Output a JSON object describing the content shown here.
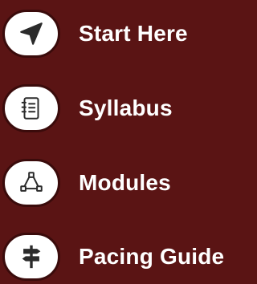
{
  "colors": {
    "background": "#5a1414",
    "circle_fill": "#ffffff",
    "circle_border": "#3a0b0b",
    "icon": "#2b2b2b",
    "label": "#ffffff"
  },
  "nav": {
    "items": [
      {
        "label": "Start Here",
        "icon": "navigation-arrow-icon"
      },
      {
        "label": "Syllabus",
        "icon": "notebook-icon"
      },
      {
        "label": "Modules",
        "icon": "modules-network-icon"
      },
      {
        "label": "Pacing Guide",
        "icon": "signpost-icon"
      }
    ]
  }
}
